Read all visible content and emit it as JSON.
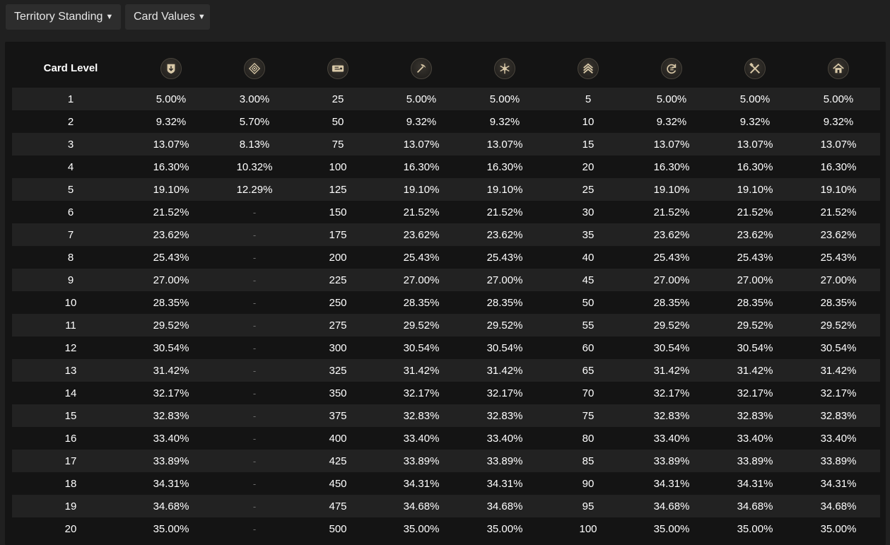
{
  "toolbar": {
    "territory_label": "Territory Standing",
    "values_label": "Card Values",
    "caret": "▼"
  },
  "table": {
    "level_header": "Card Level",
    "columns": [
      {
        "icon": "shield-icon"
      },
      {
        "icon": "diamond-icon"
      },
      {
        "icon": "ticket-icon"
      },
      {
        "icon": "pickaxe-icon"
      },
      {
        "icon": "snowflake-icon"
      },
      {
        "icon": "chevron-rank-icon"
      },
      {
        "icon": "cycle-icon"
      },
      {
        "icon": "crossed-tools-icon"
      },
      {
        "icon": "house-icon"
      }
    ],
    "rows": [
      [
        "1",
        "5.00%",
        "3.00%",
        "25",
        "5.00%",
        "5.00%",
        "5",
        "5.00%",
        "5.00%",
        "5.00%"
      ],
      [
        "2",
        "9.32%",
        "5.70%",
        "50",
        "9.32%",
        "9.32%",
        "10",
        "9.32%",
        "9.32%",
        "9.32%"
      ],
      [
        "3",
        "13.07%",
        "8.13%",
        "75",
        "13.07%",
        "13.07%",
        "15",
        "13.07%",
        "13.07%",
        "13.07%"
      ],
      [
        "4",
        "16.30%",
        "10.32%",
        "100",
        "16.30%",
        "16.30%",
        "20",
        "16.30%",
        "16.30%",
        "16.30%"
      ],
      [
        "5",
        "19.10%",
        "12.29%",
        "125",
        "19.10%",
        "19.10%",
        "25",
        "19.10%",
        "19.10%",
        "19.10%"
      ],
      [
        "6",
        "21.52%",
        "-",
        "150",
        "21.52%",
        "21.52%",
        "30",
        "21.52%",
        "21.52%",
        "21.52%"
      ],
      [
        "7",
        "23.62%",
        "-",
        "175",
        "23.62%",
        "23.62%",
        "35",
        "23.62%",
        "23.62%",
        "23.62%"
      ],
      [
        "8",
        "25.43%",
        "-",
        "200",
        "25.43%",
        "25.43%",
        "40",
        "25.43%",
        "25.43%",
        "25.43%"
      ],
      [
        "9",
        "27.00%",
        "-",
        "225",
        "27.00%",
        "27.00%",
        "45",
        "27.00%",
        "27.00%",
        "27.00%"
      ],
      [
        "10",
        "28.35%",
        "-",
        "250",
        "28.35%",
        "28.35%",
        "50",
        "28.35%",
        "28.35%",
        "28.35%"
      ],
      [
        "11",
        "29.52%",
        "-",
        "275",
        "29.52%",
        "29.52%",
        "55",
        "29.52%",
        "29.52%",
        "29.52%"
      ],
      [
        "12",
        "30.54%",
        "-",
        "300",
        "30.54%",
        "30.54%",
        "60",
        "30.54%",
        "30.54%",
        "30.54%"
      ],
      [
        "13",
        "31.42%",
        "-",
        "325",
        "31.42%",
        "31.42%",
        "65",
        "31.42%",
        "31.42%",
        "31.42%"
      ],
      [
        "14",
        "32.17%",
        "-",
        "350",
        "32.17%",
        "32.17%",
        "70",
        "32.17%",
        "32.17%",
        "32.17%"
      ],
      [
        "15",
        "32.83%",
        "-",
        "375",
        "32.83%",
        "32.83%",
        "75",
        "32.83%",
        "32.83%",
        "32.83%"
      ],
      [
        "16",
        "33.40%",
        "-",
        "400",
        "33.40%",
        "33.40%",
        "80",
        "33.40%",
        "33.40%",
        "33.40%"
      ],
      [
        "17",
        "33.89%",
        "-",
        "425",
        "33.89%",
        "33.89%",
        "85",
        "33.89%",
        "33.89%",
        "33.89%"
      ],
      [
        "18",
        "34.31%",
        "-",
        "450",
        "34.31%",
        "34.31%",
        "90",
        "34.31%",
        "34.31%",
        "34.31%"
      ],
      [
        "19",
        "34.68%",
        "-",
        "475",
        "34.68%",
        "34.68%",
        "95",
        "34.68%",
        "34.68%",
        "34.68%"
      ],
      [
        "20",
        "35.00%",
        "-",
        "500",
        "35.00%",
        "35.00%",
        "100",
        "35.00%",
        "35.00%",
        "35.00%"
      ]
    ]
  },
  "colors": {
    "page_bg": "#202020",
    "panel_bg": "#141414",
    "row_alt": "#222222",
    "icon_gold": "#d9c9a8"
  }
}
